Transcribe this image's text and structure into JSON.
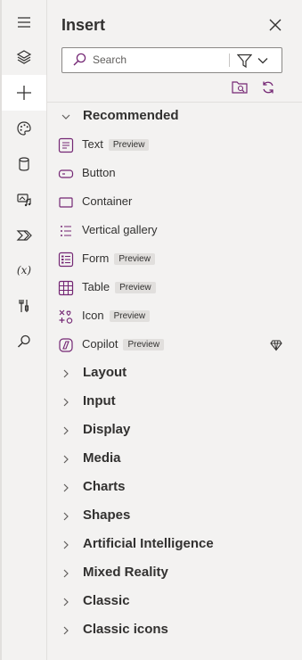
{
  "rail": {
    "items": [
      {
        "icon": "hamburger-menu-icon"
      },
      {
        "icon": "layers-icon"
      },
      {
        "icon": "add-icon",
        "active": true
      },
      {
        "icon": "palette-icon"
      },
      {
        "icon": "database-icon"
      },
      {
        "icon": "media-icon"
      },
      {
        "icon": "power-automate-icon"
      },
      {
        "icon": "variables-icon"
      },
      {
        "icon": "advanced-tools-icon"
      },
      {
        "icon": "search-icon"
      }
    ]
  },
  "panel": {
    "title": "Insert",
    "search_placeholder": "Search"
  },
  "recommended": {
    "label": "Recommended",
    "items": [
      {
        "name": "Text",
        "badge": "Preview"
      },
      {
        "name": "Button",
        "badge": ""
      },
      {
        "name": "Container",
        "badge": ""
      },
      {
        "name": "Vertical gallery",
        "badge": ""
      },
      {
        "name": "Form",
        "badge": "Preview"
      },
      {
        "name": "Table",
        "badge": "Preview"
      },
      {
        "name": "Icon",
        "badge": "Preview"
      },
      {
        "name": "Copilot",
        "badge": "Preview"
      }
    ]
  },
  "sections": [
    {
      "label": "Layout"
    },
    {
      "label": "Input"
    },
    {
      "label": "Display"
    },
    {
      "label": "Media"
    },
    {
      "label": "Charts"
    },
    {
      "label": "Shapes"
    },
    {
      "label": "Artificial Intelligence"
    },
    {
      "label": "Mixed Reality"
    },
    {
      "label": "Classic"
    },
    {
      "label": "Classic icons"
    }
  ],
  "colors": {
    "accent": "#742774",
    "icon_gray": "#323130"
  }
}
